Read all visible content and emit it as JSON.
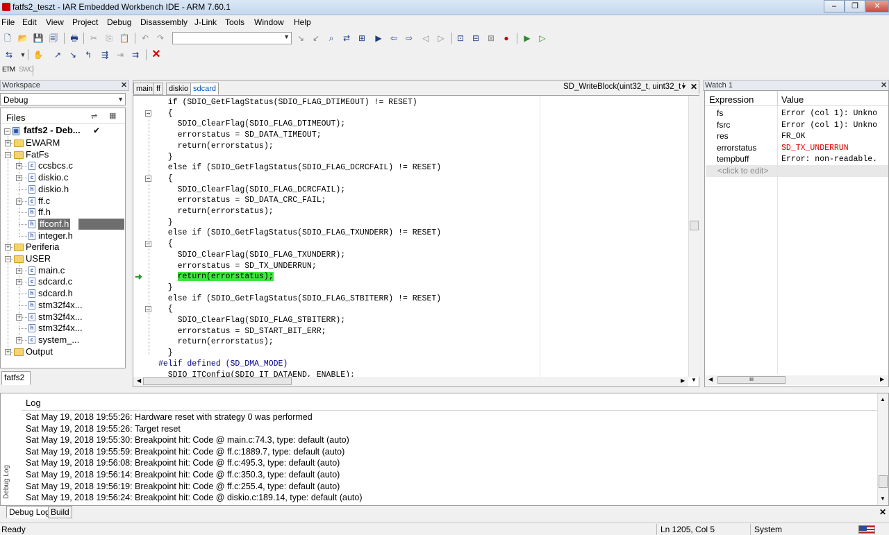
{
  "window": {
    "title": "fatfs2_teszt - IAR Embedded Workbench IDE - ARM 7.60.1"
  },
  "menu": [
    "File",
    "Edit",
    "View",
    "Project",
    "Debug",
    "Disassembly",
    "J-Link",
    "Tools",
    "Window",
    "Help"
  ],
  "toolbar3": {
    "etm": "ETM",
    "swo": "SWO"
  },
  "workspace": {
    "title": "Workspace",
    "config": "Debug",
    "files_header": "Files",
    "project": "fatfs2 - Deb...",
    "tab": "fatfs2",
    "tree": [
      {
        "label": "EWARM",
        "kind": "folder",
        "level": 1,
        "exp": "+"
      },
      {
        "label": "FatFs",
        "kind": "folder",
        "level": 1,
        "exp": "-"
      },
      {
        "label": "ccsbcs.c",
        "kind": "c",
        "level": 2,
        "exp": "+"
      },
      {
        "label": "diskio.c",
        "kind": "c",
        "level": 2,
        "exp": "+"
      },
      {
        "label": "diskio.h",
        "kind": "h",
        "level": 2,
        "exp": ""
      },
      {
        "label": "ff.c",
        "kind": "c",
        "level": 2,
        "exp": "+"
      },
      {
        "label": "ff.h",
        "kind": "h",
        "level": 2,
        "exp": ""
      },
      {
        "label": "ffconf.h",
        "kind": "h",
        "level": 2,
        "exp": "",
        "selected": true
      },
      {
        "label": "integer.h",
        "kind": "h",
        "level": 2,
        "exp": ""
      },
      {
        "label": "Periferia",
        "kind": "folder",
        "level": 1,
        "exp": "+"
      },
      {
        "label": "USER",
        "kind": "folder",
        "level": 1,
        "exp": "-"
      },
      {
        "label": "main.c",
        "kind": "c",
        "level": 2,
        "exp": "+"
      },
      {
        "label": "sdcard.c",
        "kind": "c",
        "level": 2,
        "exp": "+"
      },
      {
        "label": "sdcard.h",
        "kind": "h",
        "level": 2,
        "exp": ""
      },
      {
        "label": "stm32f4x...",
        "kind": "h",
        "level": 2,
        "exp": ""
      },
      {
        "label": "stm32f4x...",
        "kind": "c",
        "level": 2,
        "exp": "+"
      },
      {
        "label": "stm32f4x...",
        "kind": "h",
        "level": 2,
        "exp": ""
      },
      {
        "label": "system_...",
        "kind": "c",
        "level": 2,
        "exp": "+"
      },
      {
        "label": "Output",
        "kind": "folder",
        "level": 1,
        "exp": "+"
      }
    ]
  },
  "editor": {
    "tabs": [
      "main",
      "ff",
      "diskio",
      "sdcard"
    ],
    "active_tab": "sdcard",
    "function_combo": "SD_WriteBlock(uint32_t, uint32_t '",
    "lines": [
      "  if (SDIO_GetFlagStatus(SDIO_FLAG_DTIMEOUT) != RESET)",
      "  {",
      "    SDIO_ClearFlag(SDIO_FLAG_DTIMEOUT);",
      "    errorstatus = SD_DATA_TIMEOUT;",
      "    return(errorstatus);",
      "  }",
      "  else if (SDIO_GetFlagStatus(SDIO_FLAG_DCRCFAIL) != RESET)",
      "  {",
      "    SDIO_ClearFlag(SDIO_FLAG_DCRCFAIL);",
      "    errorstatus = SD_DATA_CRC_FAIL;",
      "    return(errorstatus);",
      "  }",
      "  else if (SDIO_GetFlagStatus(SDIO_FLAG_TXUNDERR) != RESET)",
      "  {",
      "    SDIO_ClearFlag(SDIO_FLAG_TXUNDERR);",
      "    errorstatus = SD_TX_UNDERRUN;",
      "    return(errorstatus);",
      "  }",
      "  else if (SDIO_GetFlagStatus(SDIO_FLAG_STBITERR) != RESET)",
      "  {",
      "    SDIO_ClearFlag(SDIO_FLAG_STBITERR);",
      "    errorstatus = SD_START_BIT_ERR;",
      "    return(errorstatus);",
      "  }",
      "#elif defined (SD_DMA_MODE)",
      "  SDIO_ITConfig(SDIO_IT_DATAEND, ENABLE);"
    ],
    "current_line_index": 16
  },
  "watch": {
    "title": "Watch 1",
    "col_expression": "Expression",
    "col_value": "Value",
    "rows": [
      {
        "expr": "fs",
        "value": "Error (col 1): Unkno"
      },
      {
        "expr": "fsrc",
        "value": "Error (col 1): Unkno"
      },
      {
        "expr": "res",
        "value": "FR_OK"
      },
      {
        "expr": "errorstatus",
        "value": "SD_TX_UNDERRUN",
        "changed": true
      },
      {
        "expr": "tempbuff",
        "value": "Error: non-readable."
      }
    ],
    "placeholder": "<click to edit>",
    "scroll_marker": "III"
  },
  "log": {
    "header": "Log",
    "side_label": "Debug Log",
    "lines": [
      "Sat May 19, 2018 19:55:26: Hardware reset with strategy 0 was performed",
      "Sat May 19, 2018 19:55:26: Target reset",
      "Sat May 19, 2018 19:55:30: Breakpoint hit: Code @ main.c:74.3, type: default (auto)",
      "Sat May 19, 2018 19:55:59: Breakpoint hit: Code @ ff.c:1889.7, type: default (auto)",
      "Sat May 19, 2018 19:56:08: Breakpoint hit: Code @ ff.c:495.3, type: default (auto)",
      "Sat May 19, 2018 19:56:14: Breakpoint hit: Code @ ff.c:350.3, type: default (auto)",
      "Sat May 19, 2018 19:56:19: Breakpoint hit: Code @ ff.c:255.4, type: default (auto)",
      "Sat May 19, 2018 19:56:24: Breakpoint hit: Code @ diskio.c:189.14, type: default (auto)"
    ],
    "tabs": [
      "Debug Log",
      "Build"
    ]
  },
  "status": {
    "ready": "Ready",
    "position": "Ln 1205, Col 5",
    "mode": "System"
  },
  "colors": {
    "current_line_bg": "#3ee63e",
    "changed_value": "#e00000",
    "keyword": "#00008b"
  }
}
